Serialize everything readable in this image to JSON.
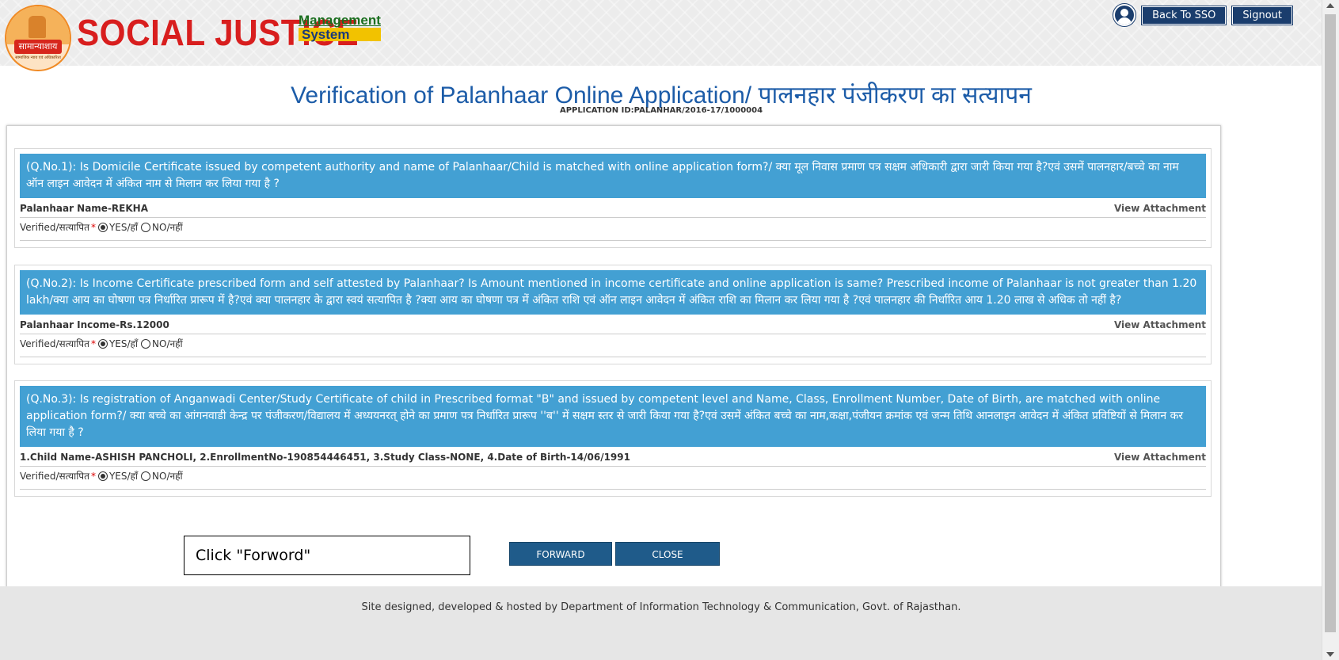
{
  "header": {
    "emblem_text": "सामान्याशाय",
    "emblem_subtext": "सामाजिक न्याय एवं अधिकारिता",
    "brand_title": "SOCIAL JUSTICE",
    "brand_line1": "Management",
    "brand_line2": "System",
    "back_to_sso": "Back To SSO",
    "signout": "Signout"
  },
  "page": {
    "title": "Verification of Palanhaar Online Application/ पालनहार पंजीकरण का सत्यापन",
    "application_id": "APPLICATION ID:PALANHAR/2016-17/1000004"
  },
  "questions": [
    {
      "text": "(Q.No.1): Is Domicile Certificate issued by competent authority and name of Palanhaar/Child is matched with online application form?/ क्या मूल निवास प्रमाण पत्र सक्षम अधिकारी द्वारा जारी किया गया है?एवं उसमें पालनहार/बच्चे का नाम ऑन लाइन आवेदन में अंकित नाम से मिलान कर लिया गया है ?",
      "detail": "Palanhaar Name-REKHA",
      "attachment": "View Attachment",
      "verified_label": "Verified/सत्यापित",
      "yes": "YES/हाँ",
      "no": "NO/नहीं"
    },
    {
      "text": "(Q.No.2): Is Income Certificate prescribed form and self attested by Palanhaar? Is Amount mentioned in income certificate and online application is same? Prescribed income of Palanhaar is not greater than 1.20 lakh/क्या आय का घोषणा पत्र निर्धारित प्रारूप में है?एवं क्या पालनहार के द्वारा स्वयं सत्यापित है ?क्या आय का घोषणा पत्र में अंकित राशि एवं ऑन लाइन आवेदन में अंकित राशि का मिलान कर लिया गया है ?एवं पालनहार की निर्धारित आय 1.20 लाख से अधिक तो नहीं है?",
      "detail": "Palanhaar Income-Rs.12000",
      "attachment": "View Attachment",
      "verified_label": "Verified/सत्यापित",
      "yes": "YES/हाँ",
      "no": "NO/नहीं"
    },
    {
      "text": "(Q.No.3): Is registration of Anganwadi Center/Study Certificate of child in Prescribed format \"B\" and issued by competent level and Name, Class, Enrollment Number, Date of Birth, are matched with online application form?/ क्या बच्चे का आंगनवाडी केन्द्र पर पंजीकरण/विद्यालय में अध्ययनरत् होने का प्रमाण पत्र निर्धारित प्रारूप ''ब'' में सक्षम स्तर से जारी किया गया है?एवं उसमें अंकित बच्चे का नाम,कक्षा,पंजीयन क्रमांक एवं जन्म तिथि आनलाइन आवेदन में अंकित प्रविष्टियों से मिलान कर लिया गया है ?",
      "detail": "1.Child Name-ASHISH PANCHOLI, 2.EnrollmentNo-190854446451, 3.Study Class-NONE, 4.Date of Birth-14/06/1991",
      "attachment": "View Attachment",
      "verified_label": "Verified/सत्यापित",
      "yes": "YES/हाँ",
      "no": "NO/नहीं"
    }
  ],
  "note": "Click \"Forword\"",
  "buttons": {
    "forward": "FORWARD",
    "close": "CLOSE"
  },
  "footer": "Site designed, developed & hosted by Department of Information Technology & Communication, Govt. of Rajasthan.",
  "colors": {
    "header_blue": "#43a0d3",
    "title_blue": "#1c5ca8",
    "button_navy": "#1f5b8a",
    "brand_red": "#d81e1e"
  }
}
